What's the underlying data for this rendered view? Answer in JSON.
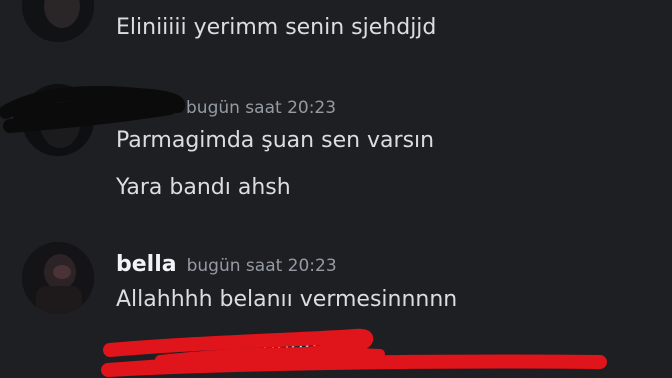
{
  "messages": {
    "m1": {
      "text": "Eliniiiii yerimm senin sjehdjjd"
    },
    "m2": {
      "timestamp": "bugün saat 20:23",
      "lines": [
        "Parmagimda şuan sen varsın",
        "Yara bandı ahsh"
      ]
    },
    "m3": {
      "username": "bella",
      "timestamp": "bugün saat 20:23",
      "lines": [
        "Allahhhh belanıı vermesinnnnn",
        "nnnn"
      ]
    }
  },
  "colors": {
    "background": "#1e1f22",
    "username": "#f2f3f5",
    "timestamp": "#949ba4",
    "text": "#dbdee1",
    "redaction_red": "#e0141b",
    "redaction_black": "#0b0b0c"
  }
}
